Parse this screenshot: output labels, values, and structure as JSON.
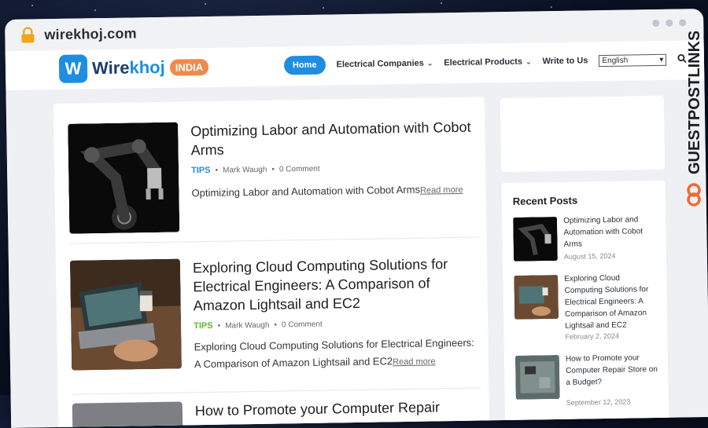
{
  "browser": {
    "url": "wirekhoj.com"
  },
  "header": {
    "logo_mark": "W",
    "logo_word_a": "Wire",
    "logo_word_b": "khoj",
    "logo_badge": "INDIA",
    "nav": {
      "home": "Home",
      "electrical_companies": "Electrical Companies",
      "electrical_products": "Electrical Products",
      "write_to_us": "Write to Us"
    },
    "language": "English"
  },
  "posts": [
    {
      "title": "Optimizing Labor and Automation with Cobot Arms",
      "tag": "TIPS",
      "tag_color": "#1f8de0",
      "author": "Mark Waugh",
      "comments": "0 Comment",
      "excerpt": "Optimizing Labor and Automation with Cobot Arms",
      "read_more": "Read more"
    },
    {
      "title": "Exploring Cloud Computing Solutions for Electrical Engineers: A Comparison of Amazon Lightsail and EC2",
      "tag": "TIPS",
      "tag_color": "#5cb82e",
      "author": "Mark Waugh",
      "comments": "0 Comment",
      "excerpt": "Exploring Cloud Computing Solutions for Electrical Engineers: A Comparison of Amazon Lightsail and EC2",
      "read_more": "Read more"
    },
    {
      "title": "How to Promote your Computer Repair"
    }
  ],
  "sidebar": {
    "recent_title": "Recent Posts",
    "recent": [
      {
        "title": "Optimizing Labor and Automation with Cobot Arms",
        "date": "August 15, 2024"
      },
      {
        "title": "Exploring Cloud Computing Solutions for Electrical Engineers: A Comparison of Amazon Lightsail and EC2",
        "date": "February 2, 2024"
      },
      {
        "title": "How to Promote your Computer Repair Store on a Budget?",
        "date": "September 12, 2023"
      }
    ]
  },
  "watermark": "GUESTPOSTLINKS",
  "colors": {
    "accent": "#1f8de0",
    "badge": "#f08a4b",
    "watermark": "#1b1e24",
    "watermark_logo": "#f06a35"
  },
  "icons": [
    "lock-icon",
    "search-icon",
    "chevron-down-icon"
  ]
}
